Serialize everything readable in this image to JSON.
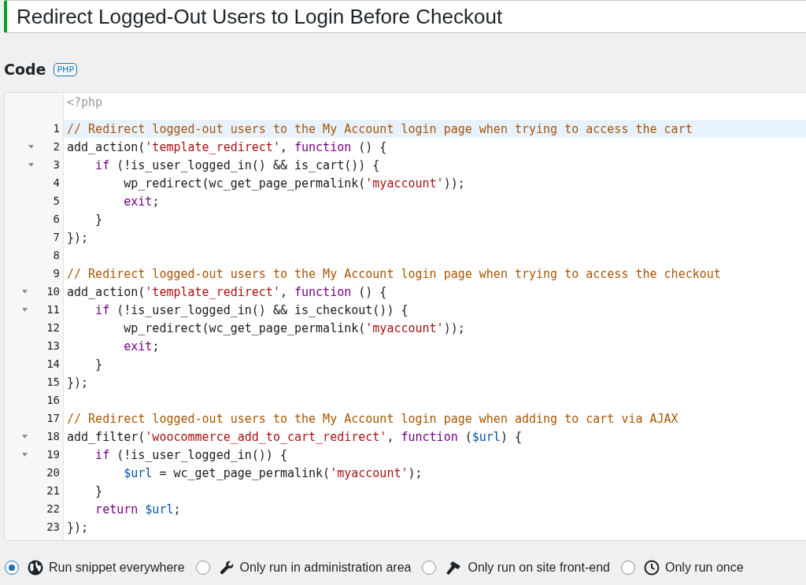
{
  "title_field": {
    "value": "Redirect Logged-Out Users to Login Before Checkout"
  },
  "code_section": {
    "heading": "Code",
    "language_badge": "PHP"
  },
  "editor": {
    "opening_tag": "<?php",
    "lines": [
      {
        "number": "1",
        "foldable": false,
        "active": true,
        "tokens": [
          {
            "kind": "comment",
            "text": "// Redirect logged-out users to the My Account login page when trying to access the cart"
          }
        ]
      },
      {
        "number": "2",
        "foldable": true,
        "active": false,
        "tokens": [
          {
            "kind": "plain",
            "text": "add_action("
          },
          {
            "kind": "string",
            "text": "'template_redirect'"
          },
          {
            "kind": "plain",
            "text": ", "
          },
          {
            "kind": "keyword",
            "text": "function"
          },
          {
            "kind": "plain",
            "text": " () {"
          }
        ]
      },
      {
        "number": "3",
        "foldable": true,
        "active": false,
        "tokens": [
          {
            "kind": "keyword",
            "text": "    if"
          },
          {
            "kind": "plain",
            "text": " (!is_user_logged_in() && is_cart()) {"
          }
        ]
      },
      {
        "number": "4",
        "foldable": false,
        "active": false,
        "tokens": [
          {
            "kind": "plain",
            "text": "        wp_redirect(wc_get_page_permalink("
          },
          {
            "kind": "string",
            "text": "'myaccount'"
          },
          {
            "kind": "plain",
            "text": "));"
          }
        ]
      },
      {
        "number": "5",
        "foldable": false,
        "active": false,
        "tokens": [
          {
            "kind": "keyword",
            "text": "        exit"
          },
          {
            "kind": "plain",
            "text": ";"
          }
        ]
      },
      {
        "number": "6",
        "foldable": false,
        "active": false,
        "tokens": [
          {
            "kind": "plain",
            "text": "    }"
          }
        ]
      },
      {
        "number": "7",
        "foldable": false,
        "active": false,
        "tokens": [
          {
            "kind": "plain",
            "text": "});"
          }
        ]
      },
      {
        "number": "8",
        "foldable": false,
        "active": false
      },
      {
        "number": "9",
        "foldable": false,
        "active": false,
        "tokens": [
          {
            "kind": "comment",
            "text": "// Redirect logged-out users to the My Account login page when trying to access the checkout"
          }
        ]
      },
      {
        "number": "10",
        "foldable": true,
        "active": false,
        "tokens": [
          {
            "kind": "plain",
            "text": "add_action("
          },
          {
            "kind": "string",
            "text": "'template_redirect'"
          },
          {
            "kind": "plain",
            "text": ", "
          },
          {
            "kind": "keyword",
            "text": "function"
          },
          {
            "kind": "plain",
            "text": " () {"
          }
        ]
      },
      {
        "number": "11",
        "foldable": true,
        "active": false,
        "tokens": [
          {
            "kind": "keyword",
            "text": "    if"
          },
          {
            "kind": "plain",
            "text": " (!is_user_logged_in() && is_checkout()) {"
          }
        ]
      },
      {
        "number": "12",
        "foldable": false,
        "active": false,
        "tokens": [
          {
            "kind": "plain",
            "text": "        wp_redirect(wc_get_page_permalink("
          },
          {
            "kind": "string",
            "text": "'myaccount'"
          },
          {
            "kind": "plain",
            "text": "));"
          }
        ]
      },
      {
        "number": "13",
        "foldable": false,
        "active": false,
        "tokens": [
          {
            "kind": "keyword",
            "text": "        exit"
          },
          {
            "kind": "plain",
            "text": ";"
          }
        ]
      },
      {
        "number": "14",
        "foldable": false,
        "active": false,
        "tokens": [
          {
            "kind": "plain",
            "text": "    }"
          }
        ]
      },
      {
        "number": "15",
        "foldable": false,
        "active": false,
        "tokens": [
          {
            "kind": "plain",
            "text": "});"
          }
        ]
      },
      {
        "number": "16",
        "foldable": false,
        "active": false
      },
      {
        "number": "17",
        "foldable": false,
        "active": false,
        "tokens": [
          {
            "kind": "comment",
            "text": "// Redirect logged-out users to the My Account login page when adding to cart via AJAX"
          }
        ]
      },
      {
        "number": "18",
        "foldable": true,
        "active": false,
        "tokens": [
          {
            "kind": "plain",
            "text": "add_filter("
          },
          {
            "kind": "string",
            "text": "'woocommerce_add_to_cart_redirect'"
          },
          {
            "kind": "plain",
            "text": ", "
          },
          {
            "kind": "keyword",
            "text": "function"
          },
          {
            "kind": "plain",
            "text": " ("
          },
          {
            "kind": "variable",
            "text": "$url"
          },
          {
            "kind": "plain",
            "text": ") {"
          }
        ]
      },
      {
        "number": "19",
        "foldable": true,
        "active": false,
        "tokens": [
          {
            "kind": "keyword",
            "text": "    if"
          },
          {
            "kind": "plain",
            "text": " (!is_user_logged_in()) {"
          }
        ]
      },
      {
        "number": "20",
        "foldable": false,
        "active": false,
        "tokens": [
          {
            "kind": "variable",
            "text": "        $url"
          },
          {
            "kind": "plain",
            "text": " = wc_get_page_permalink("
          },
          {
            "kind": "string",
            "text": "'myaccount'"
          },
          {
            "kind": "plain",
            "text": ");"
          }
        ]
      },
      {
        "number": "21",
        "foldable": false,
        "active": false,
        "tokens": [
          {
            "kind": "plain",
            "text": "    }"
          }
        ]
      },
      {
        "number": "22",
        "foldable": false,
        "active": false,
        "tokens": [
          {
            "kind": "keyword",
            "text": "    return"
          },
          {
            "kind": "variable",
            "text": " $url"
          },
          {
            "kind": "plain",
            "text": ";"
          }
        ]
      },
      {
        "number": "23",
        "foldable": false,
        "active": false,
        "tokens": [
          {
            "kind": "plain",
            "text": "});"
          }
        ]
      }
    ]
  },
  "scope_options": [
    {
      "label": "Run snippet everywhere",
      "selected": true
    },
    {
      "label": "Only run in administration area",
      "selected": false
    },
    {
      "label": "Only run on site front-end",
      "selected": false
    },
    {
      "label": "Only run once",
      "selected": false
    }
  ]
}
